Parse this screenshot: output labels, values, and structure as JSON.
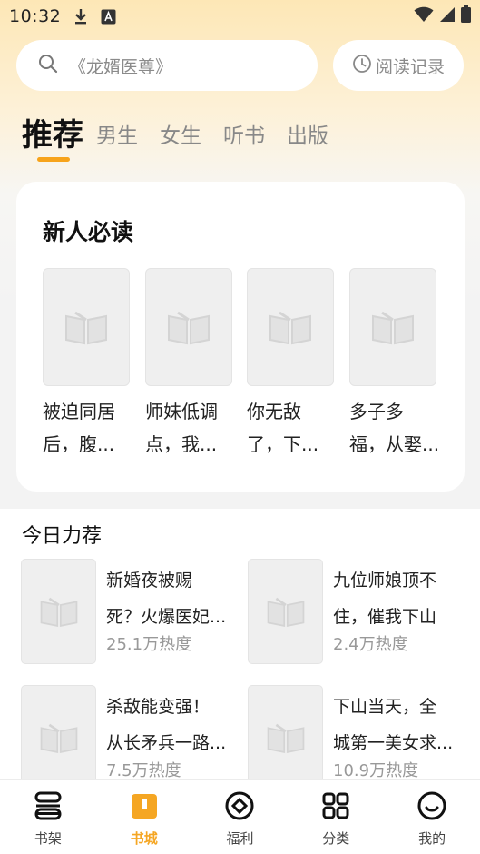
{
  "status_bar": {
    "time": "10:32"
  },
  "search": {
    "placeholder": "《龙婿医尊》",
    "history_label": "阅读记录"
  },
  "tabs": [
    {
      "label": "推荐",
      "active": true
    },
    {
      "label": "男生"
    },
    {
      "label": "女生"
    },
    {
      "label": "听书"
    },
    {
      "label": "出版"
    }
  ],
  "new_reader": {
    "title": "新人必读",
    "books": [
      {
        "title": "被迫同居\n后，腹..."
      },
      {
        "title": "师妹低调\n点，我..."
      },
      {
        "title": "你无敌\n了，下..."
      },
      {
        "title": "多子多\n福，从娶..."
      }
    ]
  },
  "today": {
    "title": "今日力荐",
    "items": [
      {
        "title": "新婚夜被赐\n死？火爆医妃...",
        "heat": "25.1万热度"
      },
      {
        "title": "九位师娘顶不\n住，催我下山",
        "heat": "2.4万热度"
      },
      {
        "title": "杀敌能变强！\n从长矛兵一路...",
        "heat": "7.5万热度"
      },
      {
        "title": "下山当天，全\n城第一美女求...",
        "heat": "10.9万热度"
      }
    ]
  },
  "bottom_nav": [
    {
      "label": "书架",
      "icon": "bookshelf-icon"
    },
    {
      "label": "书城",
      "icon": "bookstore-icon",
      "active": true
    },
    {
      "label": "福利",
      "icon": "welfare-icon"
    },
    {
      "label": "分类",
      "icon": "category-icon"
    },
    {
      "label": "我的",
      "icon": "profile-icon"
    }
  ],
  "colors": {
    "accent": "#f7a31a",
    "bg_top": "#fde7b6"
  }
}
